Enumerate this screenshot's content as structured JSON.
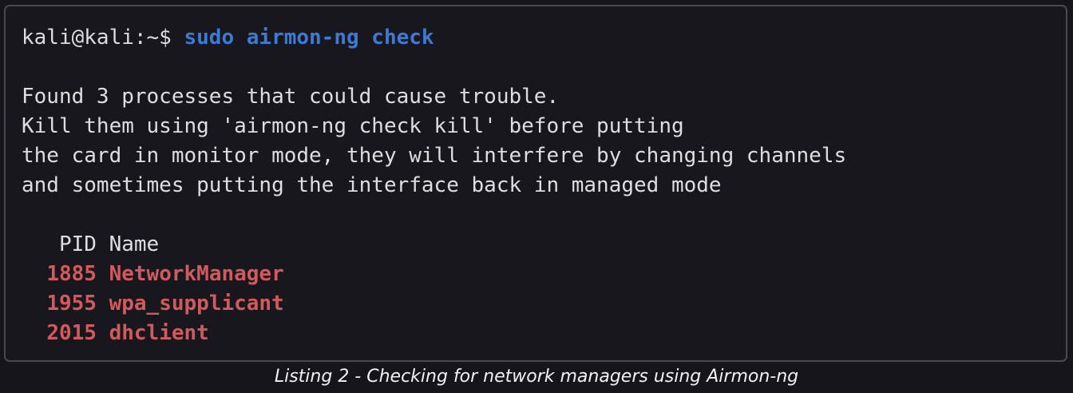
{
  "terminal": {
    "prompt": "kali@kali:~$",
    "command": "sudo airmon-ng check",
    "output_lines": [
      "Found 3 processes that could cause trouble.",
      "Kill them using 'airmon-ng check kill' before putting",
      "the card in monitor mode, they will interfere by changing channels",
      "and sometimes putting the interface back in managed mode"
    ],
    "table_header": "   PID Name",
    "processes": [
      {
        "pid": "1885",
        "name": "NetworkManager"
      },
      {
        "pid": "1955",
        "name": "wpa_supplicant"
      },
      {
        "pid": "2015",
        "name": "dhclient"
      }
    ]
  },
  "caption": "Listing 2 - Checking for network managers using Airmon-ng",
  "colors": {
    "background": "#18171d",
    "text": "#dedede",
    "command": "#3d7ad4",
    "process": "#d05a5e"
  }
}
